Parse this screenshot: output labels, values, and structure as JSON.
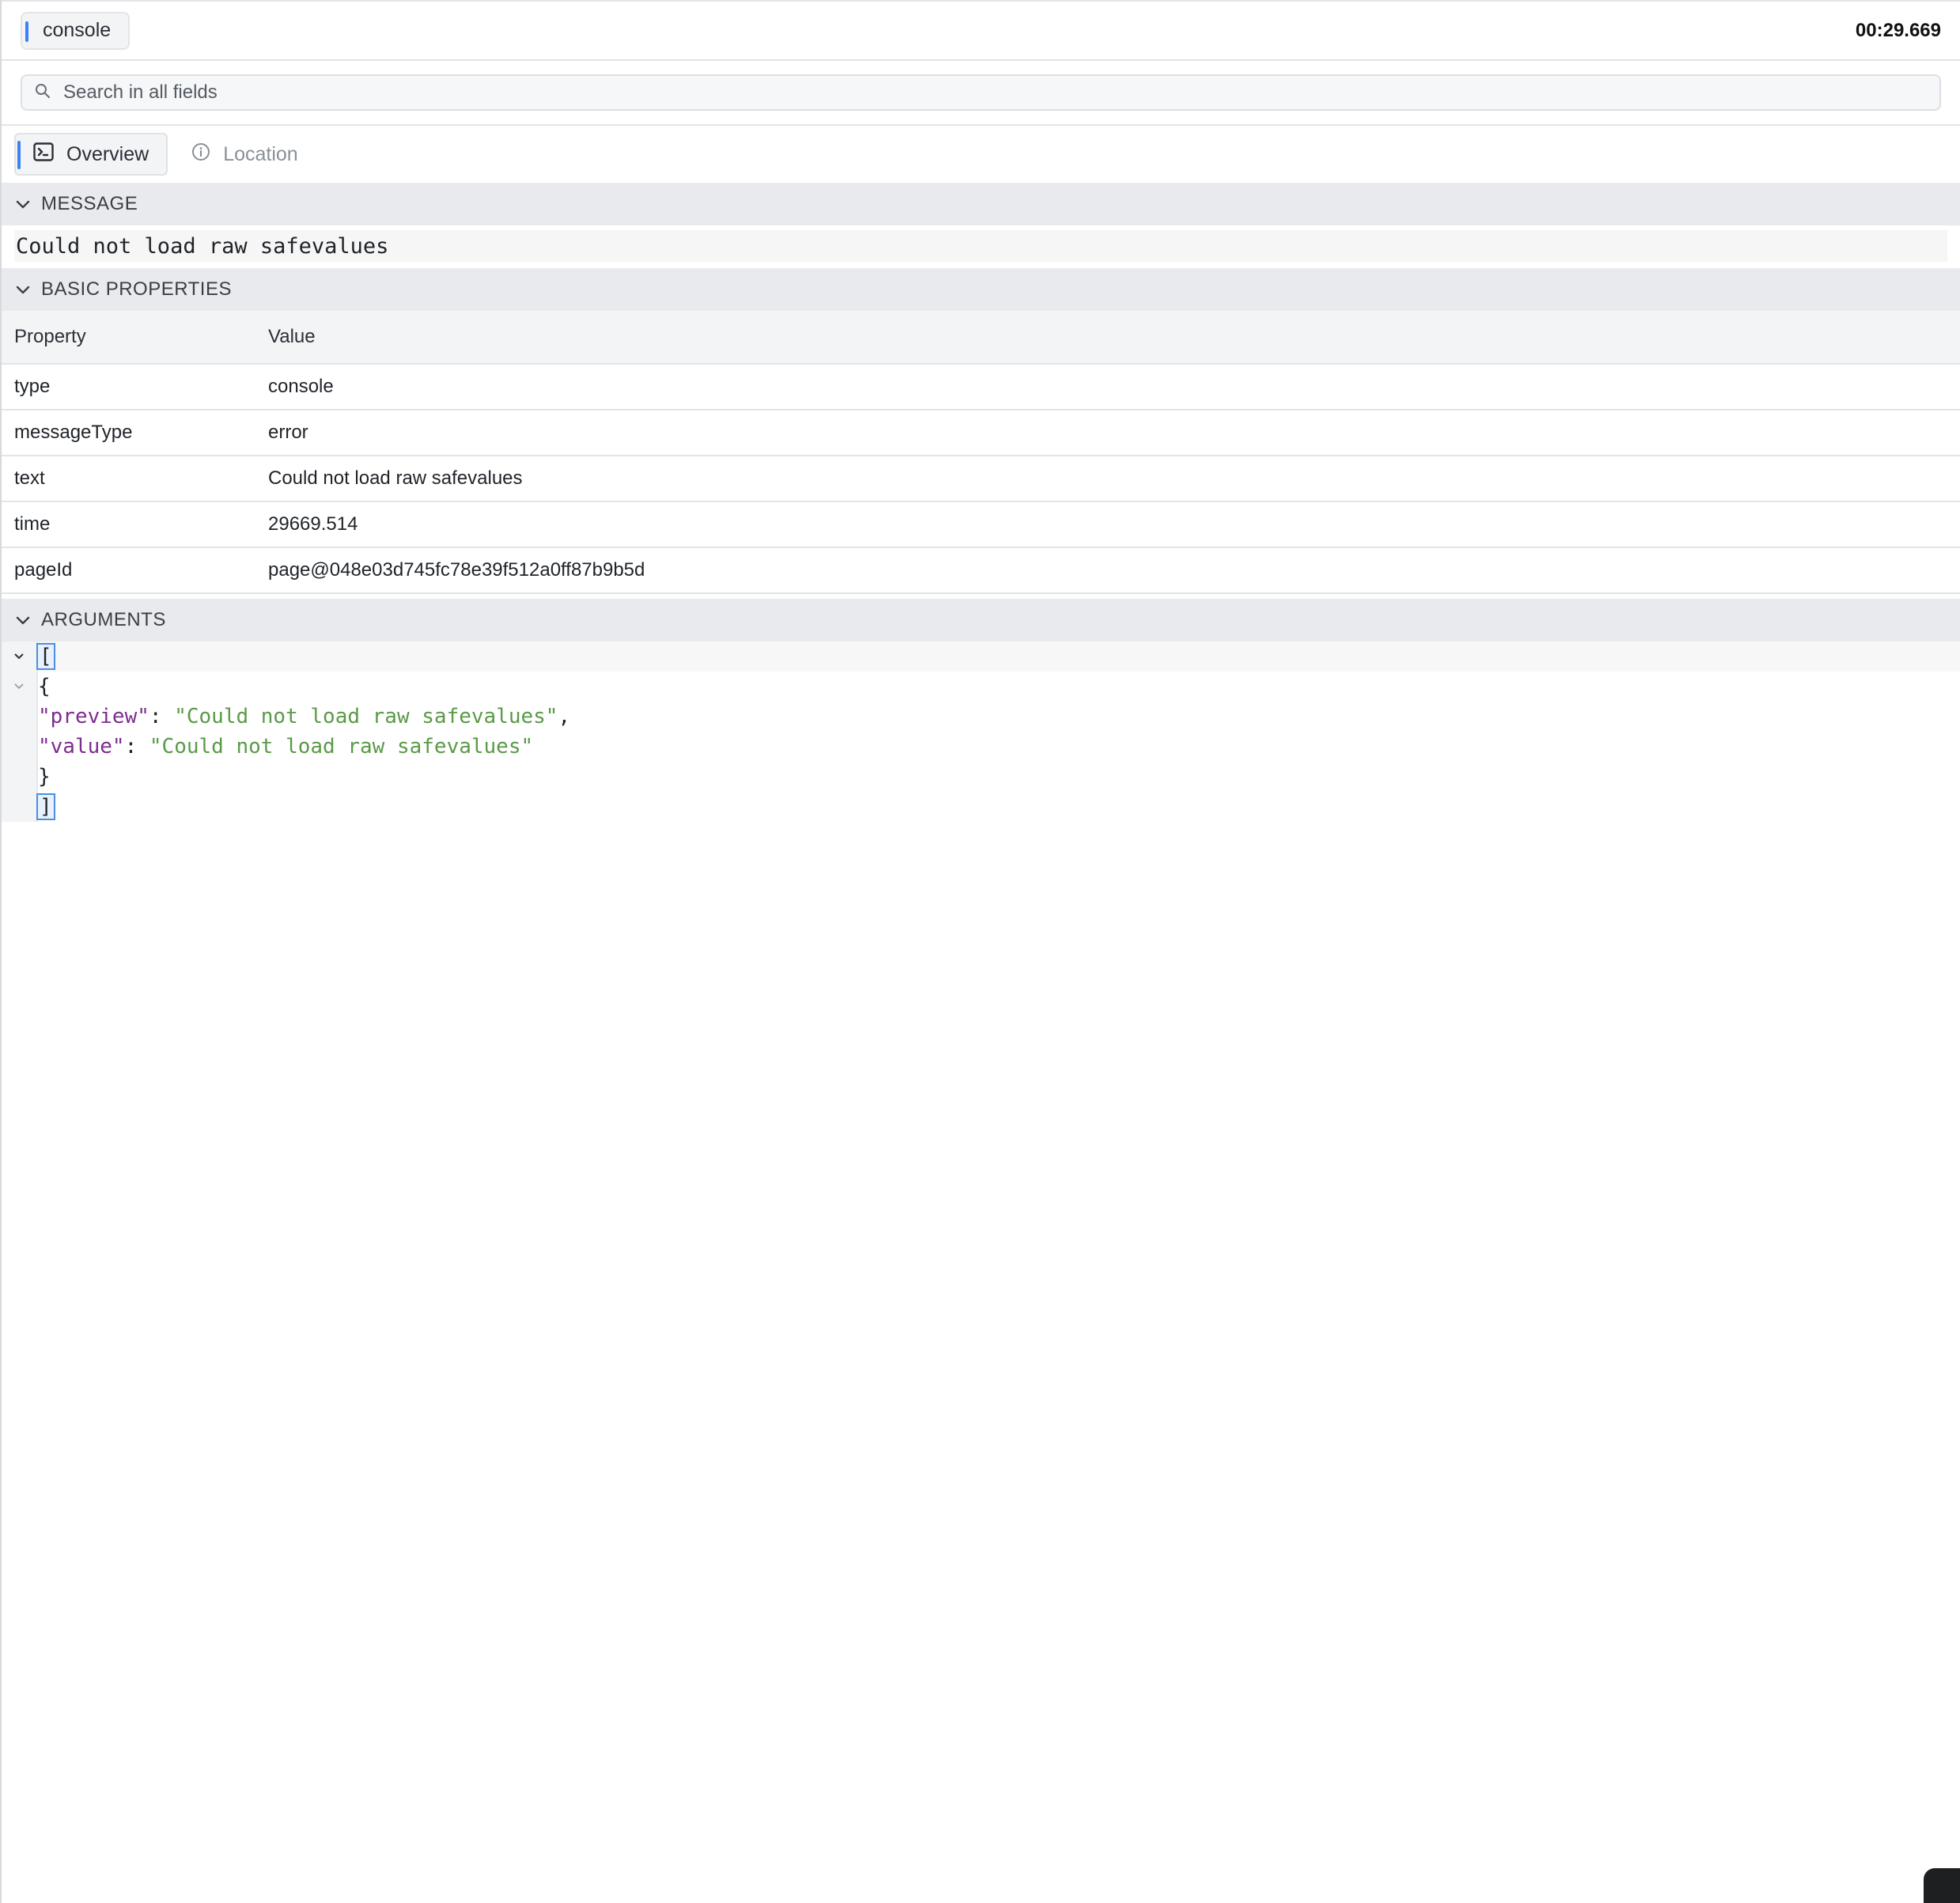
{
  "header": {
    "chip_label": "console",
    "timestamp": "00:29.669"
  },
  "search": {
    "placeholder": "Search in all fields"
  },
  "tabs": [
    {
      "label": "Overview",
      "icon": "terminal-icon",
      "active": true
    },
    {
      "label": "Location",
      "icon": "info-icon",
      "active": false
    }
  ],
  "sections": {
    "message": {
      "title": "MESSAGE",
      "text": "Could not load raw safevalues"
    },
    "basic": {
      "title": "BASIC PROPERTIES",
      "headers": {
        "property": "Property",
        "value": "Value"
      },
      "rows": [
        {
          "property": "type",
          "value": "console"
        },
        {
          "property": "messageType",
          "value": "error"
        },
        {
          "property": "text",
          "value": "Could not load raw safevalues"
        },
        {
          "property": "time",
          "value": "29669.514"
        },
        {
          "property": "pageId",
          "value": "page@048e03d745fc78e39f512a0ff87b9b5d"
        }
      ]
    },
    "arguments": {
      "title": "ARGUMENTS",
      "open_bracket": "[",
      "open_brace": "{",
      "preview_key": "\"preview\"",
      "preview_value": "\"Could not load raw safevalues\"",
      "value_key": "\"value\"",
      "value_value": "\"Could not load raw safevalues\"",
      "close_brace": "}",
      "close_bracket": "]"
    }
  },
  "colors": {
    "accent": "#3b82f6",
    "json_key": "#7d2d8e",
    "json_string": "#5a9a47"
  }
}
